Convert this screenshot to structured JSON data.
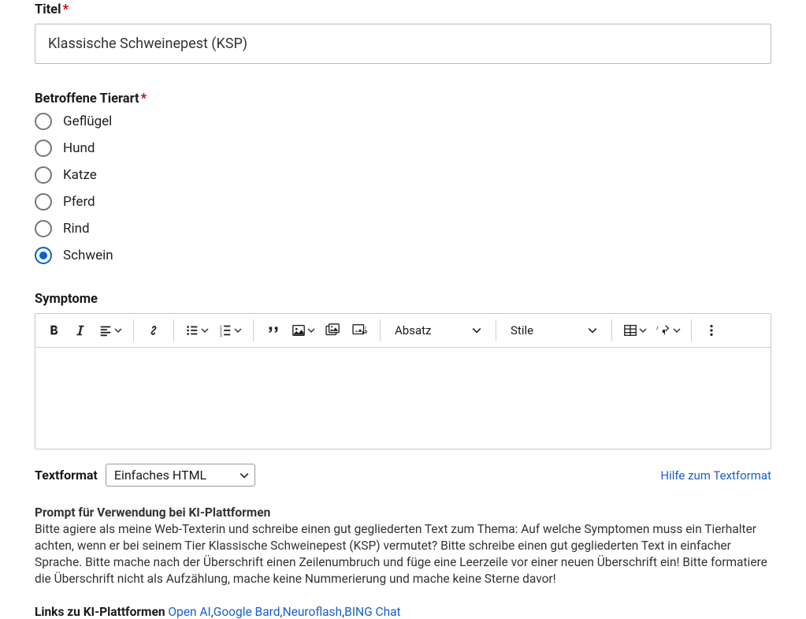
{
  "title_field": {
    "label": "Titel",
    "value": "Klassische Schweinepest (KSP)"
  },
  "species": {
    "label": "Betroffene Tierart",
    "options": [
      "Geflügel",
      "Hund",
      "Katze",
      "Pferd",
      "Rind",
      "Schwein"
    ],
    "selected_index": 5
  },
  "symptoms": {
    "label": "Symptome",
    "paragraph_dropdown": "Absatz",
    "styles_dropdown": "Stile"
  },
  "textformat": {
    "label": "Textformat",
    "selected": "Einfaches HTML",
    "help_link": "Hilfe zum Textformat"
  },
  "prompt": {
    "label": "Prompt für Verwendung bei KI-Plattformen",
    "text": "Bitte agiere als meine Web-Texterin und schreibe einen gut gegliederten Text zum Thema: Auf welche Symptomen muss ein Tierhalter achten, wenn er bei seinem Tier Klassische Schweinepest (KSP) vermutet? Bitte schreibe einen gut gegliederten Text in einfacher Sprache. Bitte mache nach der Überschrift einen Zeilenumbruch und füge eine Leerzeile vor einer neuen Überschrift ein! Bitte formatiere die Überschrift nicht als Aufzählung, mache keine Nummerierung und mache keine Sterne davor!"
  },
  "ai_links": {
    "label": "Links zu KI-Plattformen",
    "items": [
      "Open AI",
      "Google Bard",
      "Neuroflash",
      "BING Chat"
    ]
  }
}
